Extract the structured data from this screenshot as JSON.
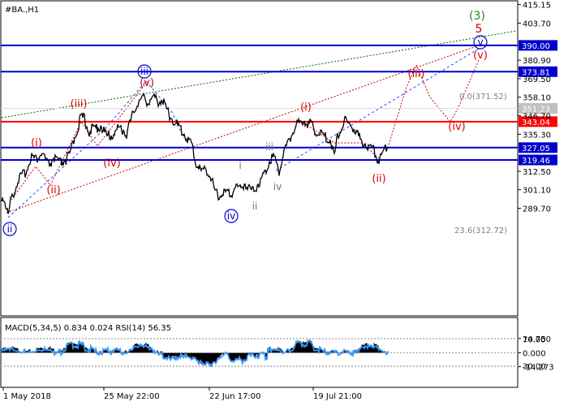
{
  "symbol": "#BA.,H1",
  "main_axis": {
    "ticks": [
      {
        "v": 415.15,
        "t": "415.15"
      },
      {
        "v": 403.7,
        "t": "403.70"
      },
      {
        "v": 380.9,
        "t": "380.90"
      },
      {
        "v": 369.5,
        "t": "369.50"
      },
      {
        "v": 358.1,
        "t": "358.10"
      },
      {
        "v": 346.7,
        "t": "346.70"
      },
      {
        "v": 335.3,
        "t": "335.30"
      },
      {
        "v": 312.5,
        "t": "312.50"
      },
      {
        "v": 301.1,
        "t": "301.10"
      },
      {
        "v": 289.7,
        "t": "289.70"
      }
    ],
    "ylim": [
      280.0,
      417.0
    ]
  },
  "levels": [
    {
      "v": 390.0,
      "label": "390.00",
      "line": "#0000cc",
      "box": "#0000cc",
      "text": "#ffffff"
    },
    {
      "v": 373.81,
      "label": "373.81",
      "line": "#0000cc",
      "box": "#0000cc",
      "text": "#ffffff"
    },
    {
      "v": 343.04,
      "label": "343.04",
      "line": "#ff0000",
      "box": "#ff0000",
      "text": "#ffffff"
    },
    {
      "v": 327.05,
      "label": "327.05",
      "line": "#0000cc",
      "box": "#0000cc",
      "text": "#ffffff"
    },
    {
      "v": 319.46,
      "label": "319.46",
      "line": "#0000cc",
      "box": "#0000cc",
      "text": "#ffffff"
    }
  ],
  "current_price": {
    "v": 351.23,
    "label": "351.23"
  },
  "fib_top": {
    "v": 371.52,
    "label": "0.0(371.52)"
  },
  "fib_bottom": {
    "v": 312.72,
    "label": "23.6(312.72)"
  },
  "wave_labels": {
    "green": [
      {
        "t": "(3)"
      }
    ],
    "red_5": [
      {
        "t": "5"
      }
    ],
    "red": [
      {
        "t": "(i)"
      },
      {
        "t": "(ii)"
      },
      {
        "t": "(iii)"
      },
      {
        "t": "(iv)"
      },
      {
        "t": "(v)"
      },
      {
        "t": "(i)"
      },
      {
        "t": "(ii)"
      },
      {
        "t": "(iii)"
      },
      {
        "t": "(iv)"
      },
      {
        "t": "(v)"
      }
    ],
    "blue_circled": [
      {
        "t": "ii"
      },
      {
        "t": "iii"
      },
      {
        "t": "iv"
      },
      {
        "t": "v"
      }
    ],
    "grey": [
      {
        "t": "i"
      },
      {
        "t": "ii"
      },
      {
        "t": "iii"
      },
      {
        "t": "iv"
      }
    ]
  },
  "indicator": {
    "label": "MACD(5,34,5) 0.834 0.024 RSI(14) 56.35",
    "ticks": [
      {
        "v": 14.75,
        "t": "14.750"
      },
      {
        "v": 0.0,
        "t": "0.000"
      },
      {
        "v": -14.273,
        "t": "-14.273"
      }
    ],
    "rsi_ticks": [
      {
        "v": 70,
        "t": "70.00"
      },
      {
        "v": 30,
        "t": "30.00"
      }
    ],
    "ylim": [
      -19.0,
      19.0
    ]
  },
  "x_labels": [
    "1 May 2018",
    "25 May 22:00",
    "22 Jun 17:00",
    "19 Jul 21:00"
  ],
  "colors": {
    "price": "#000000",
    "red": "#dd0000",
    "blue": "#0000cc",
    "green": "#006600",
    "grey": "#808080",
    "rsi": "#3399ff"
  }
}
